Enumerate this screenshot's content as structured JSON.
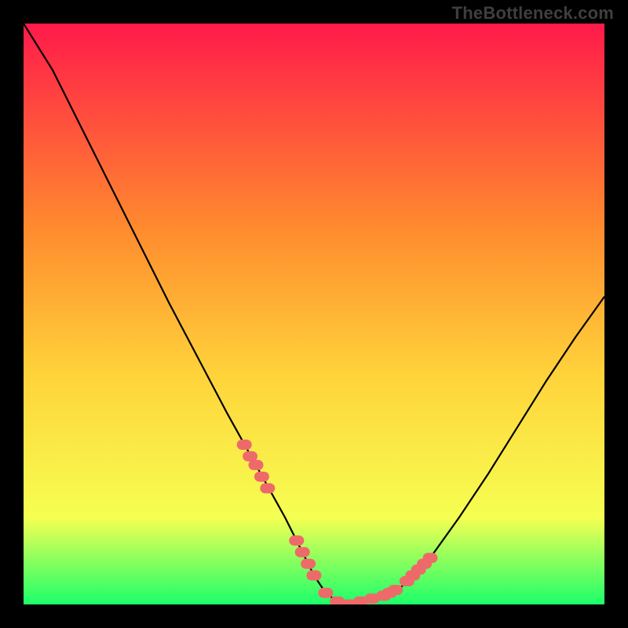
{
  "watermark": "TheBottleneck.com",
  "colors": {
    "page_bg": "#000000",
    "watermark": "#3f3f3f",
    "gradient_top": "#ff1a4a",
    "gradient_mid1": "#ff8a2e",
    "gradient_mid2": "#ffd23a",
    "gradient_mid3": "#f6ff52",
    "gradient_bottom": "#1bff6a",
    "curve": "#000000",
    "marker_fill": "#ee6a6a",
    "marker_stroke": "#ee6a6a"
  },
  "chart_data": {
    "type": "line",
    "title": "",
    "xlabel": "",
    "ylabel": "",
    "xlim": [
      0,
      100
    ],
    "ylim": [
      0,
      100
    ],
    "grid": false,
    "legend": false,
    "series": [
      {
        "name": "bottleneck-curve",
        "x": [
          0,
          5,
          10,
          15,
          20,
          25,
          30,
          35,
          40,
          45,
          48,
          50,
          52,
          54,
          56,
          58,
          60,
          62,
          65,
          70,
          75,
          80,
          85,
          90,
          95,
          100
        ],
        "values": [
          100,
          92,
          82,
          72,
          62,
          52,
          42.5,
          33,
          24,
          15,
          9,
          5,
          2,
          0.5,
          0,
          0.5,
          1,
          1.5,
          3,
          8,
          15,
          22.5,
          30.5,
          38.5,
          46,
          53
        ]
      }
    ],
    "markers": {
      "name": "highlighted-points",
      "x": [
        38,
        39,
        40,
        41,
        42,
        47,
        48,
        49,
        50,
        52,
        54,
        56,
        58,
        60,
        62,
        63,
        64,
        66,
        67,
        68,
        69,
        70
      ],
      "values": [
        27.5,
        25.5,
        24,
        22,
        20,
        11,
        9,
        7,
        5,
        2,
        0.5,
        0,
        0.5,
        1,
        1.5,
        2,
        2.5,
        4,
        5,
        6,
        7,
        8
      ]
    }
  }
}
